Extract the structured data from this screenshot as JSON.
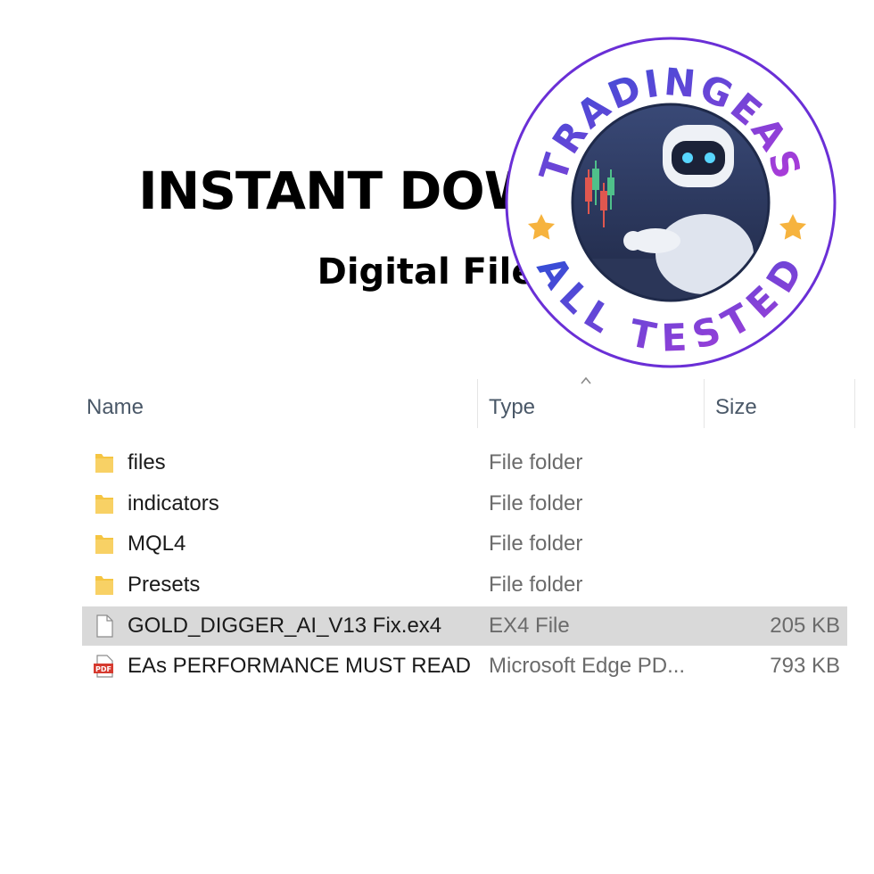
{
  "banner": {
    "headline": "INSTANT DOWNLOAD",
    "subhead": "Digital Files"
  },
  "badge": {
    "top_text": "TRADINGEAS",
    "bottom_text": "ALL TESTED",
    "ring_color": "#6a2fd6",
    "text_gradient_start": "#2a4fd6",
    "text_gradient_end": "#b43ad8",
    "star_color": "#f6b33e",
    "icon": "robot-trader-icon"
  },
  "explorer": {
    "columns": {
      "name": "Name",
      "type": "Type",
      "size": "Size"
    },
    "sort_icon": "sort-up-icon",
    "rows": [
      {
        "name": "files",
        "type": "File folder",
        "size": "",
        "icon": "folder-icon"
      },
      {
        "name": "indicators",
        "type": "File folder",
        "size": "",
        "icon": "folder-icon"
      },
      {
        "name": "MQL4",
        "type": "File folder",
        "size": "",
        "icon": "folder-icon"
      },
      {
        "name": "Presets",
        "type": "File folder",
        "size": "",
        "icon": "folder-icon"
      },
      {
        "name": "GOLD_DIGGER_AI_V13 Fix.ex4",
        "type": "EX4 File",
        "size": "205 KB",
        "icon": "file-icon",
        "selected": true
      },
      {
        "name": "EAs PERFORMANCE MUST READ",
        "type": "Microsoft Edge PD...",
        "size": "793 KB",
        "icon": "pdf-icon"
      }
    ],
    "pdf_label": "PDF",
    "selected_color": "#d9d9d9",
    "folder_color": "#f5c542"
  }
}
